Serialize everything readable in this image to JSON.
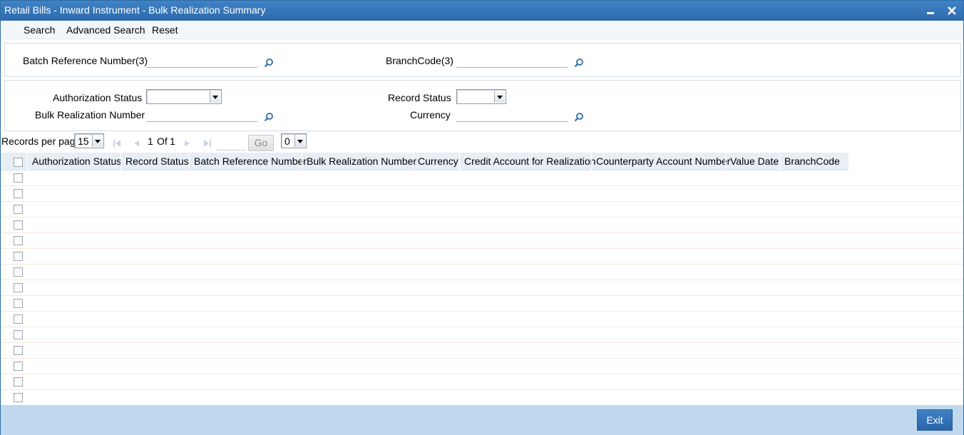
{
  "window": {
    "title": "Retail Bills - Inward Instrument - Bulk Realization Summary"
  },
  "menu": {
    "search": "Search",
    "advanced_search": "Advanced Search",
    "reset": "Reset"
  },
  "criteria": {
    "batch_ref_label": "Batch Reference Number(3)",
    "batch_ref_value": "",
    "branch_code_label": "BranchCode(3)",
    "branch_code_value": "",
    "auth_status_label": "Authorization Status",
    "auth_status_value": "",
    "record_status_label": "Record Status",
    "record_status_value": "",
    "bulk_realization_label": "Bulk Realization Number",
    "bulk_realization_value": "",
    "currency_label": "Currency",
    "currency_value": ""
  },
  "pager": {
    "records_per_page_label": "Records per page",
    "records_per_page_value": "15",
    "current_page": "1",
    "of_label": "Of",
    "total_pages": "1",
    "go_label": "Go",
    "extra_select_value": "0"
  },
  "grid": {
    "columns": [
      "Authorization Status",
      "Record Status",
      "Batch Reference Number",
      "Bulk Realization Number",
      "Currency",
      "Credit Account for Realization",
      "Counterparty Account Number",
      "Value Date",
      "BranchCode"
    ],
    "row_count": 15
  },
  "footer": {
    "exit_label": "Exit"
  },
  "colors": {
    "titlebar": "#2d6aad",
    "footer": "#c0d8ee",
    "header_bg": "#e8eef6"
  }
}
